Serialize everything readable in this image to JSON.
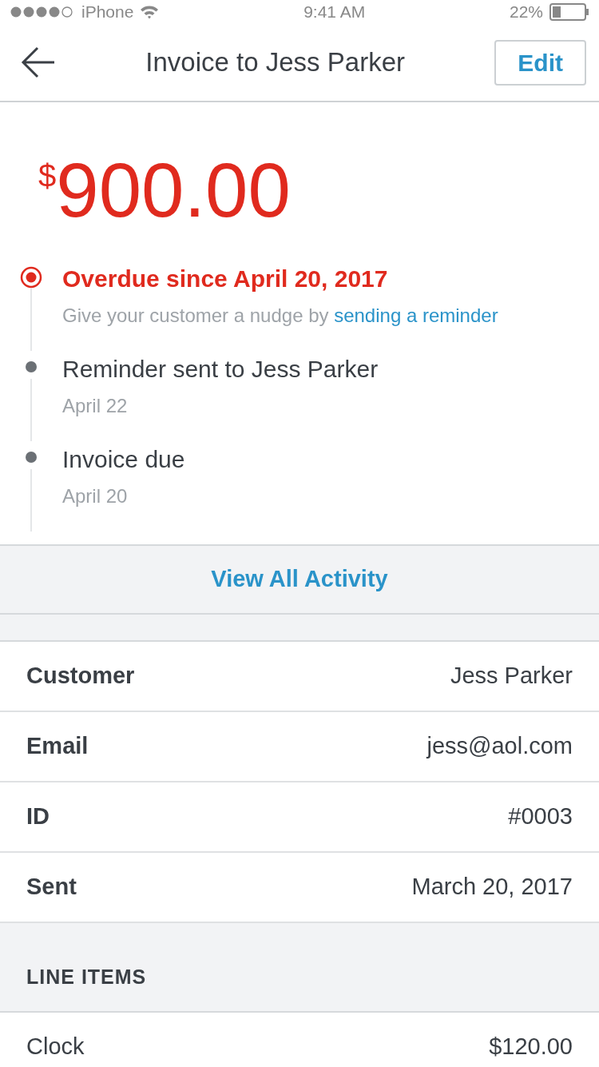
{
  "status_bar": {
    "carrier": "iPhone",
    "time": "9:41 AM",
    "battery": "22%"
  },
  "header": {
    "title": "Invoice to Jess Parker",
    "action": "Edit"
  },
  "amount": {
    "currency": "$",
    "value": "900.00"
  },
  "timeline": [
    {
      "kind": "alert",
      "title": "Overdue since April 20, 2017",
      "detail": "Give your customer a nudge by ",
      "link": "sending a reminder"
    },
    {
      "kind": "event",
      "title": "Reminder sent to Jess Parker",
      "detail": "April 22"
    },
    {
      "kind": "event",
      "title": "Invoice due",
      "detail": "April 20"
    }
  ],
  "view_all": "View All Activity",
  "details": [
    {
      "label": "Customer",
      "value": "Jess Parker"
    },
    {
      "label": "Email",
      "value": "jess@aol.com"
    },
    {
      "label": "ID",
      "value": "#0003"
    },
    {
      "label": "Sent",
      "value": "March 20, 2017"
    }
  ],
  "line_items": {
    "heading": "LINE ITEMS",
    "items": [
      {
        "name": "Clock",
        "price": "$120.00"
      }
    ]
  }
}
